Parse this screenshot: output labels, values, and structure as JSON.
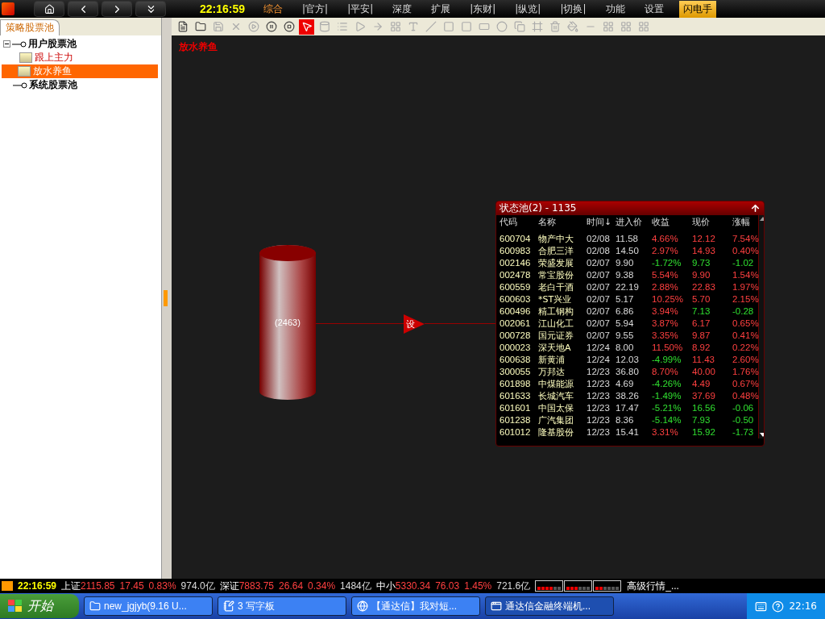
{
  "top_bar": {
    "clock": "22:16:59",
    "menu": [
      {
        "label": "综合",
        "selected": true,
        "kind": "plain"
      },
      {
        "label": "|官方|",
        "selected": false,
        "kind": "plain"
      },
      {
        "label": "|平安|",
        "selected": false,
        "kind": "plain"
      },
      {
        "label": "深度",
        "selected": false,
        "kind": "plain"
      },
      {
        "label": "扩展",
        "selected": false,
        "kind": "plain"
      },
      {
        "label": "|东财|",
        "selected": false,
        "kind": "plain"
      },
      {
        "label": "|纵览|",
        "selected": false,
        "kind": "plain"
      },
      {
        "label": "|切换|",
        "selected": false,
        "kind": "plain"
      },
      {
        "label": "功能",
        "selected": false,
        "kind": "plain"
      },
      {
        "label": "设置",
        "selected": false,
        "kind": "plain"
      },
      {
        "label": "闪电手",
        "selected": false,
        "kind": "highlight"
      }
    ]
  },
  "sidebar": {
    "tab": "策略股票池",
    "tree": [
      {
        "label": "用户股票池",
        "expanded": true,
        "children": [
          {
            "label": "跟上主力",
            "selected": false
          },
          {
            "label": "放水养鱼",
            "selected": true
          }
        ]
      },
      {
        "label": "系统股票池"
      }
    ]
  },
  "toolbar": {
    "tools": [
      {
        "kind": "doc",
        "disabled": false,
        "selected": false
      },
      {
        "kind": "folder",
        "disabled": false,
        "selected": false
      },
      {
        "kind": "save",
        "disabled": true,
        "selected": false
      },
      {
        "kind": "delete",
        "disabled": true,
        "selected": false
      },
      {
        "kind": "play",
        "disabled": true,
        "selected": false
      },
      {
        "kind": "pause",
        "disabled": false,
        "selected": false
      },
      {
        "kind": "stop",
        "disabled": false,
        "selected": false
      },
      {
        "kind": "pointer",
        "disabled": false,
        "selected": true
      },
      {
        "kind": "cylinder",
        "disabled": true,
        "selected": false
      },
      {
        "kind": "list",
        "disabled": true,
        "selected": false
      },
      {
        "kind": "triangle",
        "disabled": true,
        "selected": false
      },
      {
        "kind": "arrow",
        "disabled": true,
        "selected": false
      },
      {
        "kind": "grid",
        "disabled": true,
        "selected": false
      },
      {
        "kind": "text",
        "disabled": true,
        "selected": false
      },
      {
        "kind": "line",
        "disabled": true,
        "selected": false
      },
      {
        "kind": "rect",
        "disabled": true,
        "selected": false
      },
      {
        "kind": "rounded",
        "disabled": true,
        "selected": false
      },
      {
        "kind": "ellipse",
        "disabled": true,
        "selected": false
      },
      {
        "kind": "circle",
        "disabled": true,
        "selected": false
      },
      {
        "kind": "copy",
        "disabled": true,
        "selected": false
      },
      {
        "kind": "frame",
        "disabled": true,
        "selected": false
      },
      {
        "kind": "trash",
        "disabled": true,
        "selected": false
      },
      {
        "kind": "fill",
        "disabled": true,
        "selected": false
      },
      {
        "kind": "bar",
        "disabled": true,
        "selected": false
      },
      {
        "kind": "grid",
        "disabled": true,
        "selected": false
      },
      {
        "kind": "grid",
        "disabled": true,
        "selected": false
      },
      {
        "kind": "grid",
        "disabled": true,
        "selected": false
      }
    ]
  },
  "canvas": {
    "title": "放水养鱼",
    "pool": {
      "label": "(2463)"
    },
    "filter": {
      "label": "设"
    },
    "state_pool": {
      "title": "状态池(2) - 1135",
      "columns": [
        "代码",
        "名称",
        "时间↓",
        "进入价",
        "收益",
        "现价",
        "涨幅"
      ],
      "rows": [
        {
          "code": "600704",
          "name": "物产中大",
          "time": "02/08",
          "entry": "11.58",
          "profit": "4.66%",
          "profit_up": true,
          "price": "12.12",
          "change": "7.54%",
          "change_up": true
        },
        {
          "code": "600983",
          "name": "合肥三洋",
          "time": "02/08",
          "entry": "14.50",
          "profit": "2.97%",
          "profit_up": true,
          "price": "14.93",
          "change": "0.40%",
          "change_up": true
        },
        {
          "code": "002146",
          "name": "荣盛发展",
          "time": "02/07",
          "entry": "9.90",
          "profit": "-1.72%",
          "profit_up": false,
          "price": "9.73",
          "change": "-1.02",
          "change_up": false
        },
        {
          "code": "002478",
          "name": "常宝股份",
          "time": "02/07",
          "entry": "9.38",
          "profit": "5.54%",
          "profit_up": true,
          "price": "9.90",
          "change": "1.54%",
          "change_up": true
        },
        {
          "code": "600559",
          "name": "老白干酒",
          "time": "02/07",
          "entry": "22.19",
          "profit": "2.88%",
          "profit_up": true,
          "price": "22.83",
          "change": "1.97%",
          "change_up": true
        },
        {
          "code": "600603",
          "name": "*ST兴业",
          "time": "02/07",
          "entry": "5.17",
          "profit": "10.25%",
          "profit_up": true,
          "price": "5.70",
          "change": "2.15%",
          "change_up": true
        },
        {
          "code": "600496",
          "name": "精工钢构",
          "time": "02/07",
          "entry": "6.86",
          "profit": "3.94%",
          "profit_up": true,
          "price": "7.13",
          "change": "-0.28",
          "change_up": false
        },
        {
          "code": "002061",
          "name": "江山化工",
          "time": "02/07",
          "entry": "5.94",
          "profit": "3.87%",
          "profit_up": true,
          "price": "6.17",
          "change": "0.65%",
          "change_up": true
        },
        {
          "code": "000728",
          "name": "国元证券",
          "time": "02/07",
          "entry": "9.55",
          "profit": "3.35%",
          "profit_up": true,
          "price": "9.87",
          "change": "0.41%",
          "change_up": true
        },
        {
          "code": "000023",
          "name": "深天地A",
          "time": "12/24",
          "entry": "8.00",
          "profit": "11.50%",
          "profit_up": true,
          "price": "8.92",
          "change": "0.22%",
          "change_up": true
        },
        {
          "code": "600638",
          "name": "新黄浦",
          "time": "12/24",
          "entry": "12.03",
          "profit": "-4.99%",
          "profit_up": false,
          "price": "11.43",
          "change": "2.60%",
          "change_up": true
        },
        {
          "code": "300055",
          "name": "万邦达",
          "time": "12/23",
          "entry": "36.80",
          "profit": "8.70%",
          "profit_up": true,
          "price": "40.00",
          "change": "1.76%",
          "change_up": true
        },
        {
          "code": "601898",
          "name": "中煤能源",
          "time": "12/23",
          "entry": "4.69",
          "profit": "-4.26%",
          "profit_up": false,
          "price": "4.49",
          "change": "0.67%",
          "change_up": true
        },
        {
          "code": "601633",
          "name": "长城汽车",
          "time": "12/23",
          "entry": "38.26",
          "profit": "-1.49%",
          "profit_up": false,
          "price": "37.69",
          "change": "0.48%",
          "change_up": true
        },
        {
          "code": "601601",
          "name": "中国太保",
          "time": "12/23",
          "entry": "17.47",
          "profit": "-5.21%",
          "profit_up": false,
          "price": "16.56",
          "change": "-0.06",
          "change_up": false
        },
        {
          "code": "601238",
          "name": "广汽集团",
          "time": "12/23",
          "entry": "8.36",
          "profit": "-5.14%",
          "profit_up": false,
          "price": "7.93",
          "change": "-0.50",
          "change_up": false
        },
        {
          "code": "601012",
          "name": "隆基股份",
          "time": "12/23",
          "entry": "15.41",
          "profit": "3.31%",
          "profit_up": true,
          "price": "15.92",
          "change": "-1.73",
          "change_up": false
        }
      ]
    }
  },
  "status_bar": {
    "clock": "22:16:59",
    "markets": [
      {
        "name": "上证",
        "index": "2115.85",
        "diff": "17.45",
        "pct": "0.83%",
        "volume": "974.0亿"
      },
      {
        "name": "深证",
        "index": "7883.75",
        "diff": "26.64",
        "pct": "0.34%",
        "volume": "1484亿"
      },
      {
        "name": "中小",
        "index": "5330.34",
        "diff": "76.03",
        "pct": "1.45%",
        "volume": "721.6亿"
      }
    ],
    "feed": "高级行情_..."
  },
  "taskbar": {
    "start": "开始",
    "tasks": [
      {
        "label": "new_jgjyb(9.16 U...",
        "selected": false,
        "kind": "folder"
      },
      {
        "label": "3 写字板",
        "selected": false,
        "kind": "note"
      },
      {
        "label": "【通达信】我对短...",
        "selected": false,
        "kind": "browser"
      },
      {
        "label": "通达信金融终端机...",
        "selected": true,
        "kind": "app"
      }
    ],
    "clock": "22:16"
  }
}
